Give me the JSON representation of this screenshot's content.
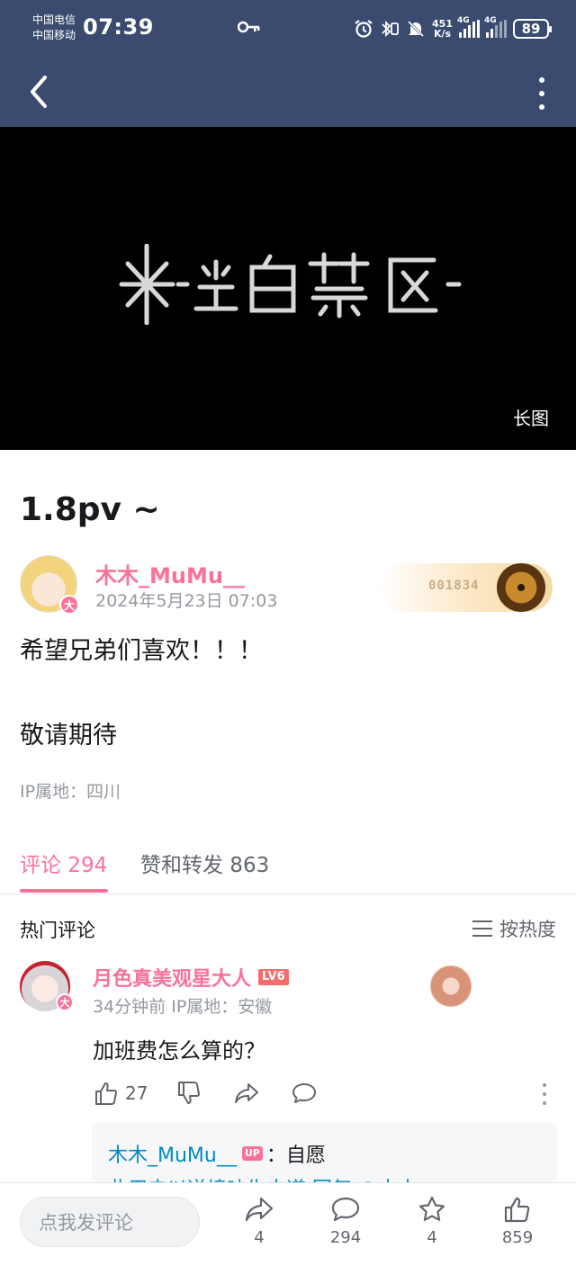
{
  "status_bar": {
    "carrier_1": "中国电信",
    "carrier_2": "中国移动",
    "time": "07:39",
    "net_speed_value": "451",
    "net_speed_unit": "K/s",
    "network_1": "4G",
    "network_2": "4G",
    "battery": "89"
  },
  "media": {
    "badge": "长图",
    "logo_icon": "game-logo-icon"
  },
  "post": {
    "title": "1.8pv ~",
    "author": "木木_MuMu__",
    "vip_badge": "大",
    "datetime": "2024年5月23日 07:03",
    "fan_card_number": "001834",
    "body_line_1": "希望兄弟们喜欢！！！",
    "body_line_2": "敬请期待",
    "ip_location": "IP属地：四川"
  },
  "tabs": {
    "comments": "评论 294",
    "likes_reposts": "赞和转发 863"
  },
  "comments_header": {
    "title": "热门评论",
    "sort_label": "按热度"
  },
  "comment": {
    "user": "月色真美观星大人",
    "level": "LV6",
    "vip_badge": "大",
    "meta": "34分钟前  IP属地：安徽",
    "text": "加班费怎么算的？",
    "like_count": "27",
    "reply": {
      "user": "木木_MuMu__",
      "up_badge": "UP",
      "text": "：自愿",
      "line2": "此用户以逆境吵生去道  回复 @古古"
    }
  },
  "bottom_bar": {
    "input_placeholder": "点我发评论",
    "share_count": "4",
    "comment_count": "294",
    "favorite_count": "4",
    "like_count": "859"
  },
  "colors": {
    "topbar": "#3a4b6f",
    "accent_pink": "#fb7299",
    "link_blue": "#008ac5",
    "text_gray": "#9499a0"
  }
}
